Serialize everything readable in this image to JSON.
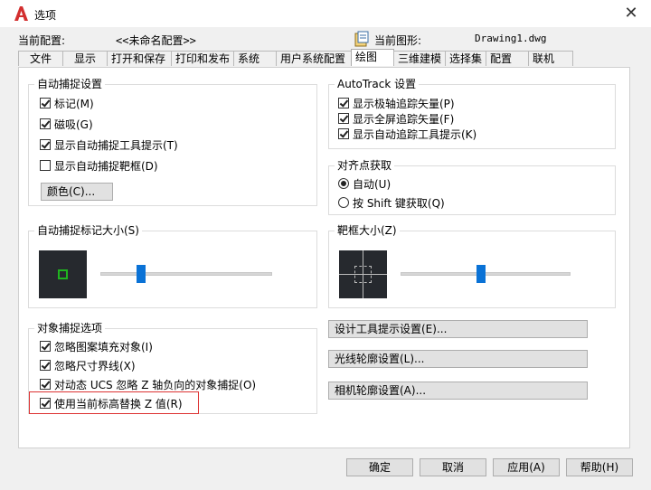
{
  "window": {
    "title": "选项",
    "close_glyph": "✕",
    "accent_color": "#d32f2f"
  },
  "profile": {
    "label": "当前配置:",
    "value": "<<未命名配置>>"
  },
  "drawing": {
    "label": "当前图形:",
    "value": "Drawing1.dwg"
  },
  "tabs": [
    {
      "label": "文件"
    },
    {
      "label": "显示"
    },
    {
      "label": "打开和保存"
    },
    {
      "label": "打印和发布"
    },
    {
      "label": "系统"
    },
    {
      "label": "用户系统配置"
    },
    {
      "label": "绘图",
      "active": true
    },
    {
      "label": "三维建模"
    },
    {
      "label": "选择集"
    },
    {
      "label": "配置"
    },
    {
      "label": "联机"
    }
  ],
  "autosnap": {
    "title": "自动捕捉设置",
    "items": [
      {
        "label": "标记(M)",
        "checked": true
      },
      {
        "label": "磁吸(G)",
        "checked": true
      },
      {
        "label": "显示自动捕捉工具提示(T)",
        "checked": true
      },
      {
        "label": "显示自动捕捉靶框(D)",
        "checked": false
      }
    ],
    "color_button": "颜色(C)..."
  },
  "autotrack": {
    "title": "AutoTrack 设置",
    "items": [
      {
        "label": "显示极轴追踪矢量(P)",
        "checked": true
      },
      {
        "label": "显示全屏追踪矢量(F)",
        "checked": true
      },
      {
        "label": "显示自动追踪工具提示(K)",
        "checked": true
      }
    ]
  },
  "alignment": {
    "title": "对齐点获取",
    "options": [
      {
        "label": "自动(U)",
        "selected": true
      },
      {
        "label": "按 Shift 键获取(Q)",
        "selected": false
      }
    ]
  },
  "marker_size": {
    "title": "自动捕捉标记大小(S)",
    "slider_fraction": 0.22,
    "marker_color": "#1fb41f"
  },
  "aperture_size": {
    "title": "靶框大小(Z)",
    "slider_fraction": 0.47
  },
  "osnap": {
    "title": "对象捕捉选项",
    "items": [
      {
        "label": "忽略图案填充对象(I)",
        "checked": true
      },
      {
        "label": "忽略尺寸界线(X)",
        "checked": true
      },
      {
        "label": "对动态 UCS 忽略 Z 轴负向的对象捕捉(O)",
        "checked": true
      },
      {
        "label": "使用当前标高替换 Z 值(R)",
        "checked": true,
        "highlighted": true
      }
    ]
  },
  "right_buttons": {
    "tooltip_settings": "设计工具提示设置(E)...",
    "light_glyph": "光线轮廓设置(L)...",
    "camera_glyph": "相机轮廓设置(A)..."
  },
  "footer": {
    "ok": "确定",
    "cancel": "取消",
    "apply": "应用(A)",
    "help": "帮助(H)"
  }
}
